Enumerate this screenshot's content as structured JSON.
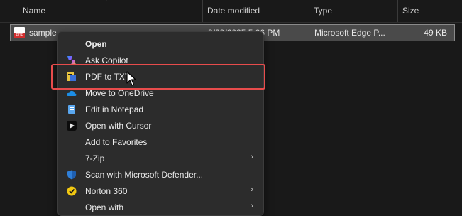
{
  "columns": {
    "name": "Name",
    "date_modified": "Date modified",
    "type": "Type",
    "size": "Size"
  },
  "file": {
    "name": "sample",
    "date_modified": "8/29/2025 5:06 PM",
    "type": "Microsoft Edge P...",
    "size": "49 KB",
    "icon": "pdf-file-icon"
  },
  "context_menu": {
    "items": [
      {
        "label": "Open",
        "icon": "none",
        "bold": true
      },
      {
        "label": "Ask Copilot",
        "icon": "copilot-icon"
      },
      {
        "label": "PDF to TXT",
        "icon": "pdf-to-txt-icon"
      },
      {
        "label": "Move to OneDrive",
        "icon": "onedrive-icon"
      },
      {
        "label": "Edit in Notepad",
        "icon": "notepad-icon"
      },
      {
        "label": "Open with Cursor",
        "icon": "cursor-app-icon"
      },
      {
        "label": "Add to Favorites",
        "icon": "none"
      },
      {
        "label": "7-Zip",
        "icon": "none",
        "submenu": true
      },
      {
        "label": "Scan with Microsoft Defender...",
        "icon": "defender-shield-icon"
      },
      {
        "label": "Norton 360",
        "icon": "norton-icon",
        "submenu": true
      },
      {
        "label": "Open with",
        "icon": "none",
        "submenu": true
      }
    ]
  },
  "colors": {
    "highlight_border": "#e84c4c",
    "selected_row": "#4a4a4a",
    "menu_bg": "#2c2c2c"
  }
}
